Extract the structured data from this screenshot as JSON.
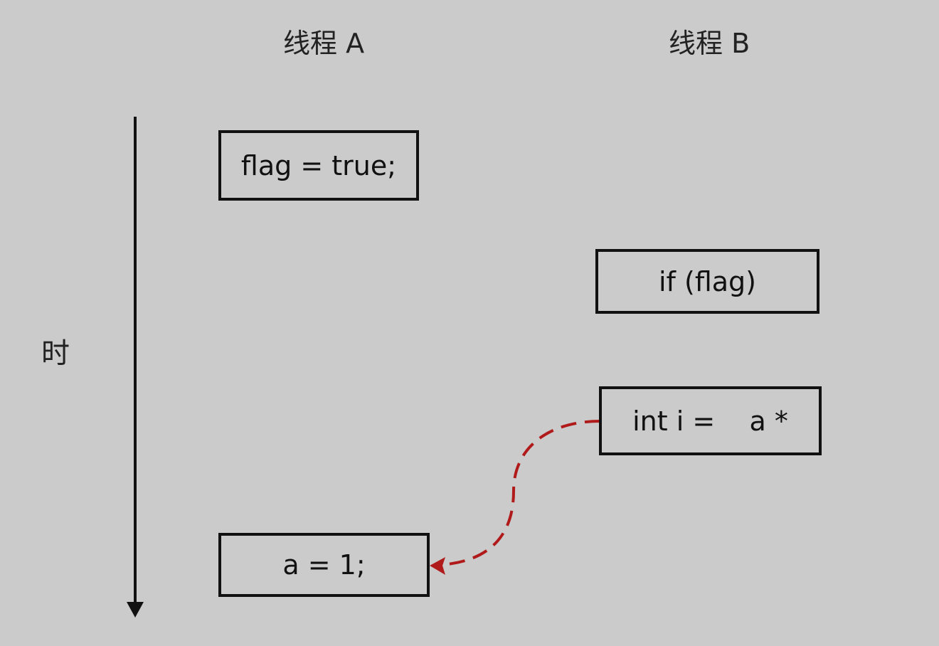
{
  "headings": {
    "thread_a": "线程 A",
    "thread_b": "线程 B"
  },
  "time_label": "时",
  "boxes": {
    "flag_true": "flag = true;",
    "if_flag": "if (flag)",
    "int_i": "int i =    a *",
    "a_assign": "a = 1;"
  },
  "colors": {
    "background": "#cbcbcb",
    "box_border": "#111111",
    "dashed_arrow": "#b01a1a"
  },
  "icons": {
    "time_axis": "down-arrow-icon",
    "dependency": "dashed-curved-arrow-icon"
  }
}
